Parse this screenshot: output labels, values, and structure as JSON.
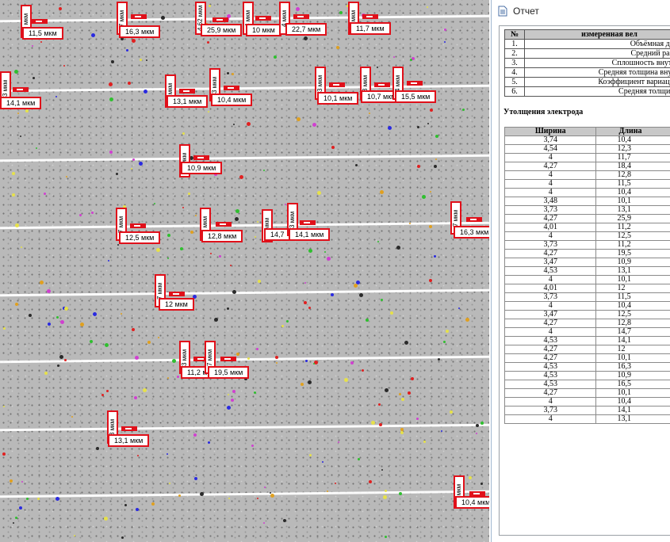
{
  "micrograph": {
    "labels": [
      {
        "text": "11,5 мкм",
        "v": "7 мкм"
      },
      {
        "text": "16,3 мкм",
        "v": "7 мкм"
      },
      {
        "text": "25,9 мкм",
        "v": "4,62 мкм"
      },
      {
        "text": "10 мкм",
        "v": "4 мкм"
      },
      {
        "text": "22,7 мкм",
        "v": "4 мкм"
      },
      {
        "text": "11,7 мкм",
        "v": "4 мкм"
      },
      {
        "text": "14,1 мкм",
        "v": "3 мкм"
      },
      {
        "text": "13,1 мкм",
        "v": "3 мкм"
      },
      {
        "text": "10,4 мкм",
        "v": "3 мкм"
      },
      {
        "text": "10,1 мкм",
        "v": "3 мкм"
      },
      {
        "text": "10,7 мкм",
        "v": "3 мкм"
      },
      {
        "text": "15,5 мкм",
        "v": "4 мкм"
      },
      {
        "text": "10,9 мкм",
        "v": "3 мкм"
      },
      {
        "text": "12,5 мкм",
        "v": "7 мкм"
      },
      {
        "text": "12,8 мкм",
        "v": "7 мкм"
      },
      {
        "text": "14,7",
        "v": "3 мкм"
      },
      {
        "text": "14,1 мкм",
        "v": "3 мкм"
      },
      {
        "text": "16,3 мкм",
        "v": "7 мкм"
      },
      {
        "text": "12 мкм",
        "v": "7 мкм"
      },
      {
        "text": "11,2 мкм",
        "v": "3 мкм"
      },
      {
        "text": "19,5 мкм",
        "v": "7 мкм"
      },
      {
        "text": "13,1 мкм",
        "v": "3 мкм"
      },
      {
        "text": "10,4 мкм",
        "v": "3 мкм"
      }
    ]
  },
  "report": {
    "window_title": "Отчет",
    "measurements_table": {
      "col_num": "№",
      "col_name": "измеренная вел",
      "rows": [
        {
          "num": "1.",
          "name": "Объёмная доля по"
        },
        {
          "num": "2.",
          "name": "Средний размер п"
        },
        {
          "num": "3.",
          "name": "Сплошность внутренне"
        },
        {
          "num": "4.",
          "name": "Средняя толщина внутренн"
        },
        {
          "num": "5.",
          "name": "Коэффициент вариации тол"
        },
        {
          "num": "6.",
          "name": "Средняя толщина диз"
        }
      ]
    },
    "section_title": "Утолщения электрода",
    "thickening_table": {
      "col_width": "Ширина",
      "col_length": "Длина",
      "rows": [
        [
          "3,74",
          "10,4"
        ],
        [
          "4,54",
          "12,3"
        ],
        [
          "4",
          "11,7"
        ],
        [
          "4,27",
          "18,4"
        ],
        [
          "4",
          "12,8"
        ],
        [
          "4",
          "11,5"
        ],
        [
          "4",
          "10,4"
        ],
        [
          "3,48",
          "10,1"
        ],
        [
          "3,73",
          "13,1"
        ],
        [
          "4,27",
          "25,9"
        ],
        [
          "4,01",
          "11,2"
        ],
        [
          "4",
          "12,5"
        ],
        [
          "3,73",
          "11,2"
        ],
        [
          "4,27",
          "19,5"
        ],
        [
          "3,47",
          "10,9"
        ],
        [
          "4,53",
          "13,1"
        ],
        [
          "4",
          "10,1"
        ],
        [
          "4,01",
          "12"
        ],
        [
          "3,73",
          "11,5"
        ],
        [
          "4",
          "10,4"
        ],
        [
          "3,47",
          "12,5"
        ],
        [
          "4,27",
          "12,8"
        ],
        [
          "4",
          "14,7"
        ],
        [
          "4,53",
          "14,1"
        ],
        [
          "4,27",
          "12"
        ],
        [
          "4,27",
          "10,1"
        ],
        [
          "4,53",
          "16,3"
        ],
        [
          "4,53",
          "10,9"
        ],
        [
          "4,53",
          "16,5"
        ],
        [
          "4,27",
          "10,1"
        ],
        [
          "4",
          "10,4"
        ],
        [
          "3,73",
          "14,1"
        ],
        [
          "4",
          "13,1"
        ]
      ]
    }
  }
}
